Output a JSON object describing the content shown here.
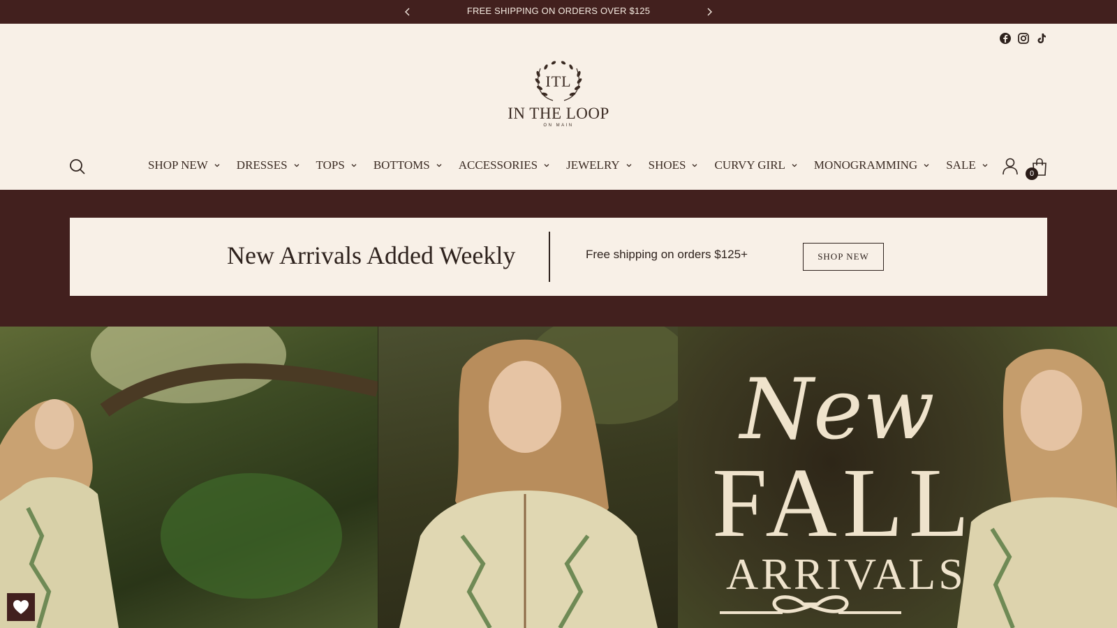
{
  "announcement": {
    "text": "FREE SHIPPING ON ORDERS OVER $125"
  },
  "social": [
    "facebook-icon",
    "instagram-icon",
    "tiktok-icon"
  ],
  "logo": {
    "monogram": "ITL",
    "name": "IN THE LOOP",
    "tagline": "ON MAIN"
  },
  "nav": {
    "items": [
      {
        "label": "SHOP NEW"
      },
      {
        "label": "DRESSES"
      },
      {
        "label": "TOPS"
      },
      {
        "label": "BOTTOMS"
      },
      {
        "label": "ACCESSORIES"
      },
      {
        "label": "JEWELRY"
      },
      {
        "label": "SHOES"
      },
      {
        "label": "CURVY GIRL"
      },
      {
        "label": "MONOGRAMMING"
      },
      {
        "label": "SALE"
      }
    ]
  },
  "cart": {
    "count": "0"
  },
  "promo": {
    "title": "New Arrivals Added Weekly",
    "shipping": "Free shipping on orders $125+",
    "button": "SHOP NEW"
  },
  "hero": {
    "line1": "New",
    "line2": "FALL",
    "line3": "ARRIVALS"
  },
  "colors": {
    "brand_dark": "#42201e",
    "cream": "#f8f0e7",
    "text": "#3a2a22"
  }
}
